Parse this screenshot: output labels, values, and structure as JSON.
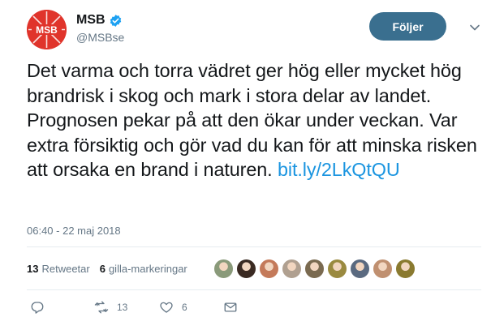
{
  "account": {
    "display_name": "MSB",
    "handle": "@MSBse",
    "avatar_text": "MSB",
    "verified": true
  },
  "follow_button": {
    "label": "Följer"
  },
  "tweet": {
    "text": "Det varma och torra vädret ger hög eller mycket hög brandrisk i skog och mark i stora delar av landet. Prognosen pekar på att den ökar under veckan. Var extra försiktig och gör vad du kan för att minska risken att orsaka en brand i naturen.",
    "link": "bit.ly/2LkQtQU",
    "timestamp": "06:40 - 22 maj 2018"
  },
  "stats": {
    "retweets_count": "13",
    "retweets_label": "Retweetar",
    "likes_count": "6",
    "likes_label": "gilla-markeringar"
  },
  "likers": [
    {
      "color": "#8a9a7a"
    },
    {
      "color": "#3a2a22"
    },
    {
      "color": "#c47a5a"
    },
    {
      "color": "#b0a090"
    },
    {
      "color": "#7a6a50"
    },
    {
      "color": "#9a8a40"
    },
    {
      "color": "#5a6a80"
    },
    {
      "color": "#c09070"
    },
    {
      "color": "#8a7a30"
    }
  ],
  "actions": {
    "reply_icon": "reply-icon",
    "retweet_count": "13",
    "like_count": "6",
    "dm_icon": "envelope-icon"
  },
  "colors": {
    "brand_red": "#e0342b",
    "follow_bg": "#3a6f8f",
    "link": "#1b95e0",
    "muted": "#657786"
  }
}
